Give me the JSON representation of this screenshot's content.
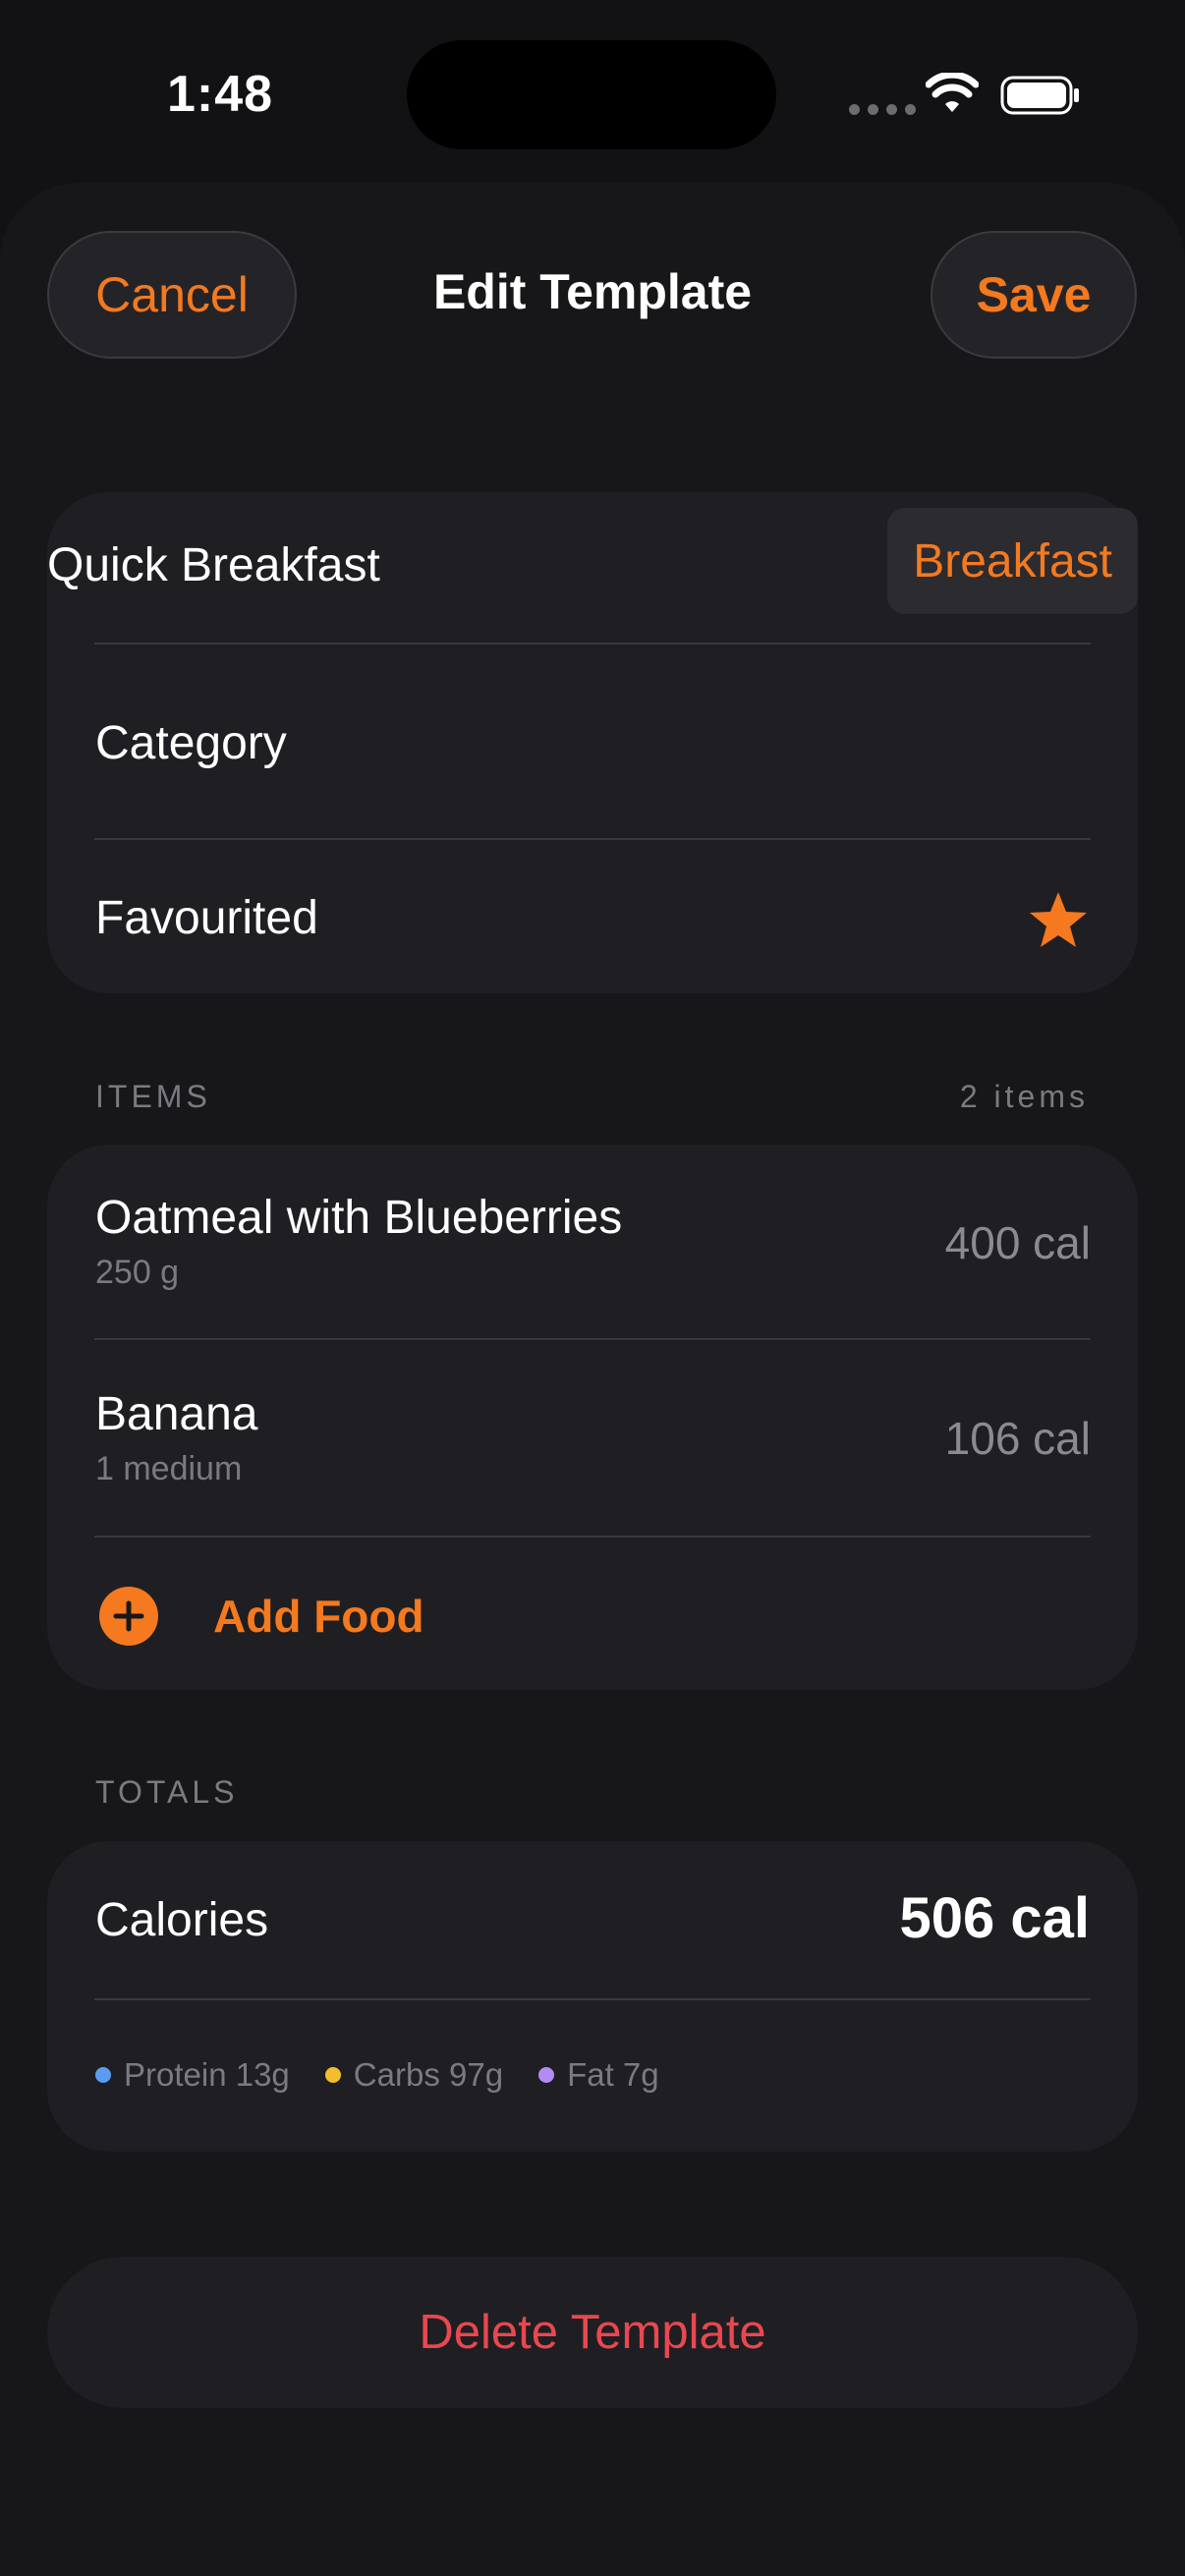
{
  "status_bar": {
    "time": "1:48",
    "icons": [
      "signal-icon",
      "wifi-icon",
      "battery-icon"
    ]
  },
  "header": {
    "cancel_label": "Cancel",
    "title": "Edit Template",
    "save_label": "Save"
  },
  "template": {
    "name": "Quick Breakfast",
    "category_label": "Category",
    "category_value": "Breakfast",
    "favourited_label": "Favourited",
    "favourited": true,
    "favourite_icon": "star-icon"
  },
  "items_section": {
    "label": "ITEMS",
    "count": "2 items",
    "items": [
      {
        "name": "Oatmeal with Blueberries",
        "portion": "250 g",
        "calories": "400 cal"
      },
      {
        "name": "Banana",
        "portion": "1 medium",
        "calories": "106 cal"
      }
    ],
    "add_label": "Add Food",
    "add_icon": "plus-circle-icon"
  },
  "totals_section": {
    "label": "TOTALS",
    "calories_label": "Calories",
    "calories_value": "506 cal",
    "macros": [
      {
        "label": "Protein 13g",
        "color": "#5b9cf2"
      },
      {
        "label": "Carbs 97g",
        "color": "#f1bf2d"
      },
      {
        "label": "Fat 7g",
        "color": "#b28cf2"
      }
    ]
  },
  "delete_label": "Delete Template",
  "colors": {
    "accent": "#f4791f",
    "destructive": "#e8484f",
    "background": "#121215",
    "card": "#1f1f23"
  }
}
